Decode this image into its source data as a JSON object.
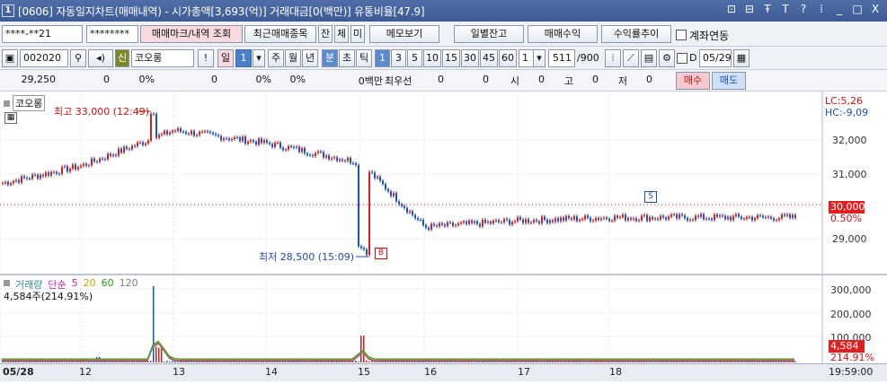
{
  "window": {
    "number": "1",
    "title": "[0606] 자동일지차트(매매내역) - 시가총액[3,693(억)] 거래대금[0(백만)] 유통비율[47.9]",
    "controls": [
      "⊡",
      "⊟",
      "Ŧ",
      "T",
      "?",
      "⁞",
      "_",
      "□",
      "X"
    ]
  },
  "toolbar1": {
    "account": "****-**21",
    "password": "********",
    "trade_mark_button": "매매마크/내역 조회",
    "recent_button": "최근매매종목",
    "btn_jan": "잔",
    "btn_che": "체",
    "btn_mi": "미",
    "memo_button": "메모보기",
    "daily_balance_button": "일별잔고",
    "trade_profit_button": "매매수익",
    "return_trend_button": "수익률추이",
    "account_link_label": "계좌연동"
  },
  "toolbar2": {
    "code": "002020",
    "credit_badge": "신",
    "stock_name": "코오롱",
    "alert": "!",
    "period_day": "일",
    "period_value": "1",
    "periods": [
      "주",
      "월",
      "년",
      "분",
      "초",
      "틱"
    ],
    "intervals": [
      "1",
      "3",
      "5",
      "10",
      "15",
      "30",
      "45",
      "60"
    ],
    "count": "1",
    "range": "511",
    "range_total": "/900",
    "date_label": "D",
    "date": "05/29"
  },
  "quote": {
    "price": "29,250",
    "change": "0",
    "change_pct": "0%",
    "volume": "0",
    "volume_pct": "0%",
    "other_pct": "0%",
    "amount": "0백만",
    "priority_label": "최우선",
    "bid": "0",
    "ask": "0",
    "open_label": "시",
    "open": "0",
    "high_label": "고",
    "high": "0",
    "low_label": "저",
    "low": "0",
    "buy_button": "매수",
    "sell_button": "매도"
  },
  "chart_panel": {
    "stock_label": "코오롱",
    "lc": "LC:5,26",
    "hc": "HC:-9,09",
    "high_annot": "최고 33,000 (12:49)",
    "low_annot": "최저 28,500 (15:09)",
    "marker_buy": "B",
    "marker_sell": "S",
    "current_price_tag": "30,000",
    "current_pct": "0.50%",
    "yticks": [
      "32,000",
      "31,000",
      "30,000",
      "29,000"
    ]
  },
  "volume_panel": {
    "legend": [
      "거래량",
      "단순",
      "5",
      "20",
      "60",
      "120"
    ],
    "legend_colors": [
      "#2a8c8c",
      "#c020c0",
      "#c020c0",
      "#c0a000",
      "#20a020",
      "#808080"
    ],
    "volume_readout": "4,584주(214.91%)",
    "yticks": [
      "300,000",
      "200,000",
      "100,000"
    ],
    "volume_tag": "4,584",
    "volume_pct_tag": "214.91%"
  },
  "time_axis": {
    "labels": [
      "05/28",
      "12",
      "13",
      "14",
      "15",
      "16",
      "17",
      "18"
    ],
    "clock": "19:59:00"
  },
  "chart_data": {
    "type": "line",
    "title": "",
    "x": [
      "05/28",
      "12",
      "13",
      "14",
      "15",
      "16",
      "17",
      "18"
    ],
    "series": [
      {
        "values": [
          30650,
          31200,
          32300,
          31900,
          31300,
          29300,
          29500,
          29600
        ]
      }
    ],
    "annotations": [
      "최고 33,000 (12:49)",
      "최저 28,500 (15:09)"
    ],
    "ylim": [
      28500,
      33400
    ]
  }
}
